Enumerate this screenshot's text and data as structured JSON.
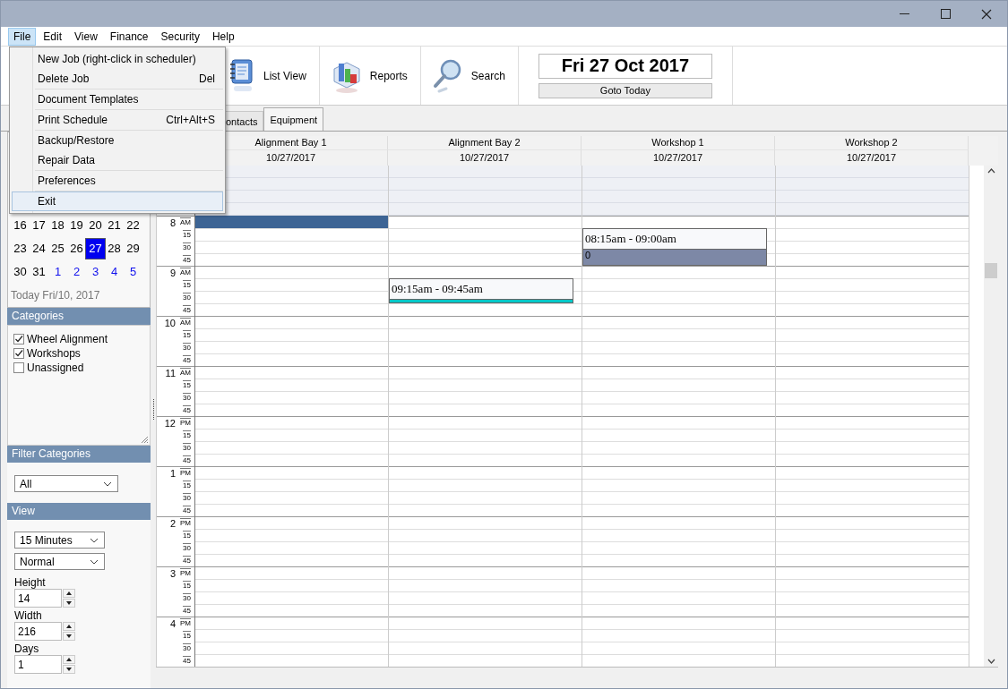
{
  "menu_bar": [
    {
      "label": "File",
      "selected": true
    },
    {
      "label": "Edit",
      "selected": false
    },
    {
      "label": "View",
      "selected": false
    },
    {
      "label": "Finance",
      "selected": false
    },
    {
      "label": "Security",
      "selected": false
    },
    {
      "label": "Help",
      "selected": false
    }
  ],
  "file_menu": {
    "groups": [
      [
        {
          "label": "New Job (right-click in scheduler)",
          "selected": false
        },
        {
          "label": "Delete Job",
          "shortcut": "Del",
          "selected": false
        }
      ],
      [
        {
          "label": "Document Templates",
          "selected": false
        }
      ],
      [
        {
          "label": "Print Schedule",
          "shortcut": "Ctrl+Alt+S",
          "selected": false
        }
      ],
      [
        {
          "label": "Backup/Restore",
          "selected": false
        },
        {
          "label": "Repair Data",
          "selected": false
        }
      ],
      [
        {
          "label": "Preferences",
          "selected": false
        }
      ],
      [
        {
          "label": "Exit",
          "selected": true
        }
      ]
    ]
  },
  "toolbar": {
    "buttons": [
      {
        "kind": "list",
        "label": "List View"
      },
      {
        "kind": "reports",
        "label": "Reports"
      },
      {
        "kind": "search",
        "label": "Search"
      }
    ],
    "date": "Fri 27 Oct 2017",
    "goto_button": "Goto Today"
  },
  "tabs": [
    {
      "label": "ontacts",
      "selected": false
    },
    {
      "label": "Equipment",
      "selected": true
    }
  ],
  "mini_calendar": {
    "weeks": [
      [
        {
          "day": "16",
          "selected": false,
          "other_month": false
        },
        {
          "day": "17",
          "selected": false,
          "other_month": false
        },
        {
          "day": "18",
          "selected": false,
          "other_month": false
        },
        {
          "day": "19",
          "selected": false,
          "other_month": false
        },
        {
          "day": "20",
          "selected": false,
          "other_month": false
        },
        {
          "day": "21",
          "selected": false,
          "other_month": false
        },
        {
          "day": "22",
          "selected": false,
          "other_month": false
        }
      ],
      [
        {
          "day": "23",
          "selected": false,
          "other_month": false
        },
        {
          "day": "24",
          "selected": false,
          "other_month": false
        },
        {
          "day": "25",
          "selected": false,
          "other_month": false
        },
        {
          "day": "26",
          "selected": false,
          "other_month": false
        },
        {
          "day": "27",
          "selected": true,
          "other_month": false
        },
        {
          "day": "28",
          "selected": false,
          "other_month": false
        },
        {
          "day": "29",
          "selected": false,
          "other_month": false
        }
      ],
      [
        {
          "day": "30",
          "selected": false,
          "other_month": false
        },
        {
          "day": "31",
          "selected": false,
          "other_month": false
        },
        {
          "day": "1",
          "selected": false,
          "other_month": true
        },
        {
          "day": "2",
          "selected": false,
          "other_month": true
        },
        {
          "day": "3",
          "selected": false,
          "other_month": true
        },
        {
          "day": "4",
          "selected": false,
          "other_month": true
        },
        {
          "day": "5",
          "selected": false,
          "other_month": true
        }
      ]
    ],
    "today_label": "Today Fri/10, 2017"
  },
  "categories": {
    "title": "Categories",
    "items": [
      {
        "label": "Wheel Alignment",
        "checked": true
      },
      {
        "label": "Workshops",
        "checked": true
      },
      {
        "label": "Unassigned",
        "checked": false
      }
    ]
  },
  "filter_categories": {
    "title": "Filter Categories",
    "value": "All"
  },
  "view": {
    "title": "View",
    "interval": "15 Minutes",
    "mode": "Normal",
    "fields": [
      {
        "label": "Height",
        "value": "14"
      },
      {
        "label": "Width",
        "value": "216"
      },
      {
        "label": "Days",
        "value": "1"
      }
    ]
  },
  "scheduler": {
    "columns": [
      {
        "name": "Alignment Bay 1",
        "date": "10/27/2017",
        "selected": true
      },
      {
        "name": "Alignment Bay 2",
        "date": "10/27/2017",
        "selected": false,
        "events": [
          {
            "time": "09:15am - 09:45am",
            "color": "#00c8c8"
          }
        ]
      },
      {
        "name": "Workshop 1",
        "date": "10/27/2017",
        "selected": false,
        "events": [
          {
            "time": "08:15am - 09:00am",
            "note": "0",
            "color": "#7d88a6"
          }
        ]
      },
      {
        "name": "Workshop 2",
        "date": "10/27/2017",
        "selected": false
      }
    ],
    "hours": [
      {
        "hour": "8",
        "period": "AM",
        "minutes": [
          "15",
          "30",
          "45"
        ]
      },
      {
        "hour": "9",
        "period": "AM",
        "minutes": [
          "15",
          "30",
          "45"
        ]
      },
      {
        "hour": "10",
        "period": "AM",
        "minutes": [
          "15",
          "30",
          "45"
        ]
      },
      {
        "hour": "11",
        "period": "AM",
        "minutes": [
          "15",
          "30",
          "45"
        ]
      },
      {
        "hour": "12",
        "period": "PM",
        "minutes": [
          "15",
          "30",
          "45"
        ]
      },
      {
        "hour": "1",
        "period": "PM",
        "minutes": [
          "15",
          "30",
          "45"
        ]
      },
      {
        "hour": "2",
        "period": "PM",
        "minutes": [
          "15",
          "30",
          "45"
        ]
      },
      {
        "hour": "3",
        "period": "PM",
        "minutes": [
          "15",
          "30",
          "45"
        ]
      },
      {
        "hour": "4",
        "period": "PM",
        "minutes": [
          "15",
          "30",
          "45"
        ]
      }
    ]
  }
}
